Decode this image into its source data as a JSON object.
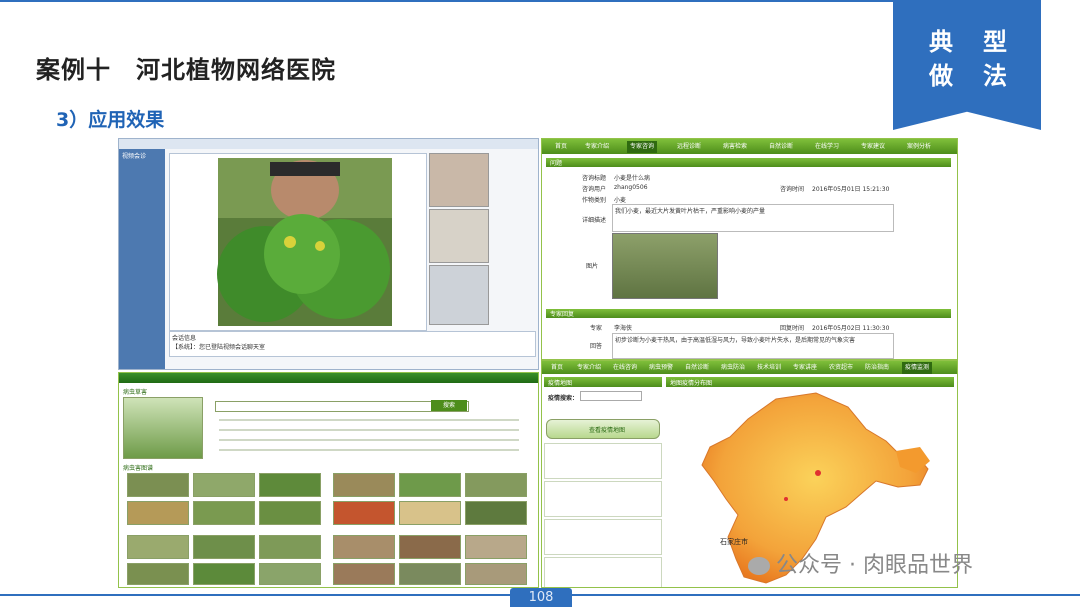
{
  "slide": {
    "title": "案例十　河北植物网络医院",
    "subtitle": "3）应用效果",
    "badge_chars": [
      "典",
      "型",
      "做",
      "法"
    ],
    "page_number": "108"
  },
  "watermark": {
    "text": "公众号 · 肉眼品世界"
  },
  "video_panel": {
    "menu": "视频会诊",
    "chat_label": "会话信息",
    "chat_line": "【系统】：您已登陆视频会话聊天室"
  },
  "expert_panel": {
    "tabs": [
      "首页",
      "专家介绍",
      "专家咨询",
      "远程诊断",
      "病害检索",
      "自然诊断",
      "在线学习",
      "专家建议",
      "案例分析"
    ],
    "section_question": "问题",
    "fields": [
      {
        "label": "咨询标题",
        "value": "小麦是什么病"
      },
      {
        "label": "咨询用户",
        "value": "zhang0506"
      },
      {
        "label": "咨询时间",
        "value": "2016年05月01日 15:21:30"
      },
      {
        "label": "作物类别",
        "value": "小麦"
      },
      {
        "label": "详细描述",
        "value": "我们小麦，最近大片发黄叶片枯干，严重影响小麦的产量"
      },
      {
        "label": "图片",
        "value": ""
      }
    ],
    "section_answer": "专家回复",
    "answer_fields": [
      {
        "label": "专家",
        "value": "李海侠"
      },
      {
        "label": "回复时间",
        "value": "2016年05月02日 11:30:30"
      },
      {
        "label": "回答",
        "value": "初步诊断为小麦干热风，由于高温低湿与风力，导致小麦叶片失水，是后期常见的气象灾害"
      }
    ]
  },
  "catalog_panel": {
    "header": "病虫草害",
    "search_btn": "搜索",
    "section": "病虫害图谱"
  },
  "map_panel": {
    "tabs": [
      "首页",
      "专家介绍",
      "在线咨询",
      "病虫预警",
      "自然诊断",
      "病虫防治",
      "技术培训",
      "专家讲座",
      "农资超市",
      "防治指南",
      "疫情监测"
    ],
    "left_header": "疫情地图",
    "search_label": "疫情搜索：",
    "btn": "查看疫情地图",
    "right_header": "地图疫情分布图",
    "city": "石家庄市"
  }
}
